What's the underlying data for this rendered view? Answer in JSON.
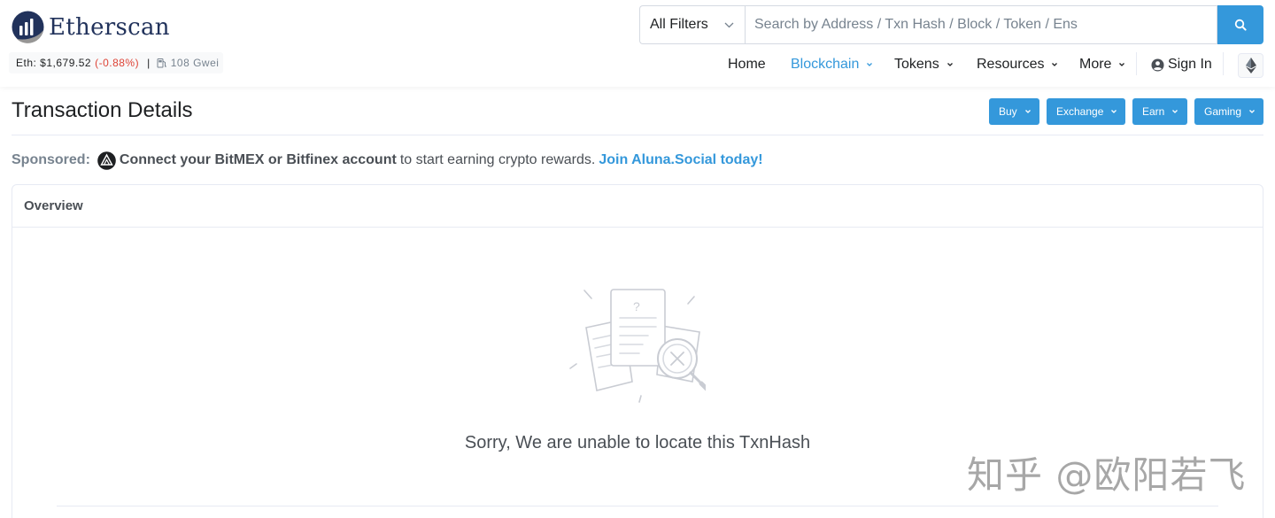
{
  "brand": {
    "name": "Etherscan"
  },
  "price_bar": {
    "eth_price": "Eth: $1,679.52",
    "change": "(-0.88%)",
    "separator": "|",
    "gas": "108 Gwei"
  },
  "search": {
    "filter_label": "All Filters",
    "placeholder": "Search by Address / Txn Hash / Block / Token / Ens"
  },
  "nav": {
    "home": "Home",
    "blockchain": "Blockchain",
    "tokens": "Tokens",
    "resources": "Resources",
    "more": "More",
    "sign_in": "Sign In"
  },
  "page": {
    "title": "Transaction Details"
  },
  "action_buttons": {
    "buy": "Buy",
    "exchange": "Exchange",
    "earn": "Earn",
    "gaming": "Gaming"
  },
  "sponsored": {
    "label": "Sponsored:",
    "bold_text": "Connect your BitMEX or Bitfinex account",
    "plain_text": "to start earning crypto rewards.",
    "link_text": "Join Aluna.Social today!"
  },
  "overview": {
    "header": "Overview",
    "empty_message": "Sorry, We are unable to locate this TxnHash"
  },
  "watermark": "知乎 @欧阳若飞",
  "colors": {
    "accent": "#3498db",
    "negative": "#de4437",
    "brand_dark": "#21325b",
    "muted": "#77838f"
  },
  "icons": [
    "etherscan-logo-icon",
    "gas-pump-icon",
    "chevron-down-icon",
    "search-icon",
    "user-circle-icon",
    "ethereum-icon",
    "aluna-logo-icon",
    "not-found-illustration"
  ]
}
